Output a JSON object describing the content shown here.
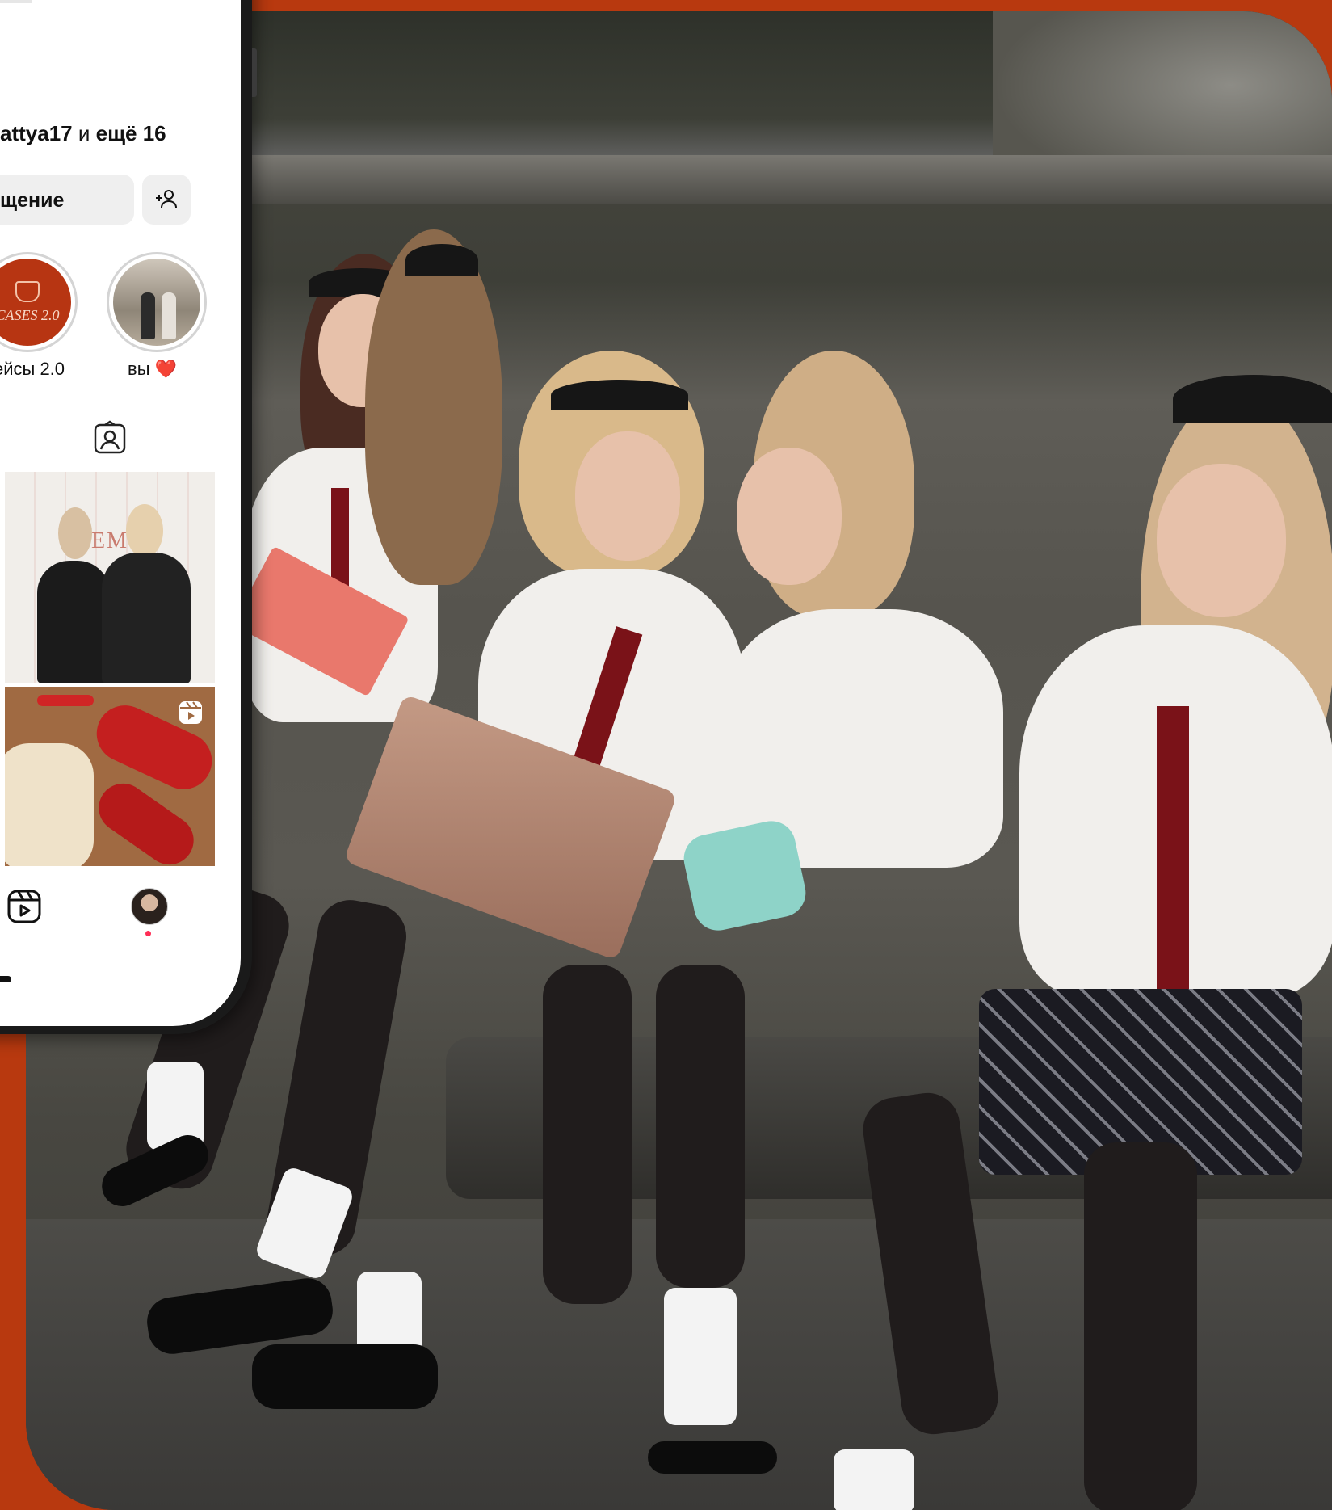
{
  "profile": {
    "followers_user": "attya17",
    "followers_connector": "и",
    "followers_more": "ещё 16",
    "message_button": "щение"
  },
  "highlights": [
    {
      "label": "ейсы 2.0",
      "cover_text": "CASES 2.0"
    },
    {
      "label": "вы ❤️"
    }
  ],
  "grid": {
    "post1_wall_text": "DEMY"
  },
  "icons": {
    "add_person": "add-person-icon",
    "tagged": "tagged-photos-icon",
    "reels": "reels-icon",
    "reel_badge": "reel-badge-icon"
  },
  "colors": {
    "background": "#b8390f",
    "notification_dot": "#ff2d55"
  }
}
